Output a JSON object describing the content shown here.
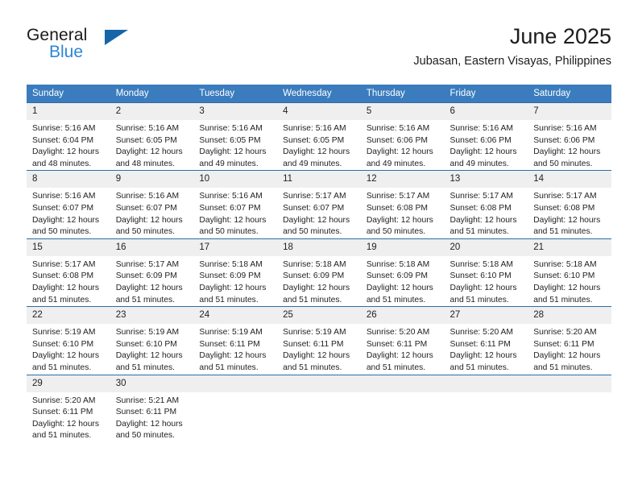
{
  "brand": {
    "name_part1": "General",
    "name_part2": "Blue",
    "triangle_color": "#1565a8",
    "blue_color": "#2e86d6"
  },
  "header": {
    "title": "June 2025",
    "subtitle": "Jubasan, Eastern Visayas, Philippines"
  },
  "theme": {
    "header_bg": "#3a7cbe",
    "row_divider": "#2e6da4",
    "daynum_bg": "#efefef"
  },
  "weekdays": [
    "Sunday",
    "Monday",
    "Tuesday",
    "Wednesday",
    "Thursday",
    "Friday",
    "Saturday"
  ],
  "days": [
    {
      "n": "1",
      "sunrise": "Sunrise: 5:16 AM",
      "sunset": "Sunset: 6:04 PM",
      "daylight": "Daylight: 12 hours and 48 minutes."
    },
    {
      "n": "2",
      "sunrise": "Sunrise: 5:16 AM",
      "sunset": "Sunset: 6:05 PM",
      "daylight": "Daylight: 12 hours and 48 minutes."
    },
    {
      "n": "3",
      "sunrise": "Sunrise: 5:16 AM",
      "sunset": "Sunset: 6:05 PM",
      "daylight": "Daylight: 12 hours and 49 minutes."
    },
    {
      "n": "4",
      "sunrise": "Sunrise: 5:16 AM",
      "sunset": "Sunset: 6:05 PM",
      "daylight": "Daylight: 12 hours and 49 minutes."
    },
    {
      "n": "5",
      "sunrise": "Sunrise: 5:16 AM",
      "sunset": "Sunset: 6:06 PM",
      "daylight": "Daylight: 12 hours and 49 minutes."
    },
    {
      "n": "6",
      "sunrise": "Sunrise: 5:16 AM",
      "sunset": "Sunset: 6:06 PM",
      "daylight": "Daylight: 12 hours and 49 minutes."
    },
    {
      "n": "7",
      "sunrise": "Sunrise: 5:16 AM",
      "sunset": "Sunset: 6:06 PM",
      "daylight": "Daylight: 12 hours and 50 minutes."
    },
    {
      "n": "8",
      "sunrise": "Sunrise: 5:16 AM",
      "sunset": "Sunset: 6:07 PM",
      "daylight": "Daylight: 12 hours and 50 minutes."
    },
    {
      "n": "9",
      "sunrise": "Sunrise: 5:16 AM",
      "sunset": "Sunset: 6:07 PM",
      "daylight": "Daylight: 12 hours and 50 minutes."
    },
    {
      "n": "10",
      "sunrise": "Sunrise: 5:16 AM",
      "sunset": "Sunset: 6:07 PM",
      "daylight": "Daylight: 12 hours and 50 minutes."
    },
    {
      "n": "11",
      "sunrise": "Sunrise: 5:17 AM",
      "sunset": "Sunset: 6:07 PM",
      "daylight": "Daylight: 12 hours and 50 minutes."
    },
    {
      "n": "12",
      "sunrise": "Sunrise: 5:17 AM",
      "sunset": "Sunset: 6:08 PM",
      "daylight": "Daylight: 12 hours and 50 minutes."
    },
    {
      "n": "13",
      "sunrise": "Sunrise: 5:17 AM",
      "sunset": "Sunset: 6:08 PM",
      "daylight": "Daylight: 12 hours and 51 minutes."
    },
    {
      "n": "14",
      "sunrise": "Sunrise: 5:17 AM",
      "sunset": "Sunset: 6:08 PM",
      "daylight": "Daylight: 12 hours and 51 minutes."
    },
    {
      "n": "15",
      "sunrise": "Sunrise: 5:17 AM",
      "sunset": "Sunset: 6:08 PM",
      "daylight": "Daylight: 12 hours and 51 minutes."
    },
    {
      "n": "16",
      "sunrise": "Sunrise: 5:17 AM",
      "sunset": "Sunset: 6:09 PM",
      "daylight": "Daylight: 12 hours and 51 minutes."
    },
    {
      "n": "17",
      "sunrise": "Sunrise: 5:18 AM",
      "sunset": "Sunset: 6:09 PM",
      "daylight": "Daylight: 12 hours and 51 minutes."
    },
    {
      "n": "18",
      "sunrise": "Sunrise: 5:18 AM",
      "sunset": "Sunset: 6:09 PM",
      "daylight": "Daylight: 12 hours and 51 minutes."
    },
    {
      "n": "19",
      "sunrise": "Sunrise: 5:18 AM",
      "sunset": "Sunset: 6:09 PM",
      "daylight": "Daylight: 12 hours and 51 minutes."
    },
    {
      "n": "20",
      "sunrise": "Sunrise: 5:18 AM",
      "sunset": "Sunset: 6:10 PM",
      "daylight": "Daylight: 12 hours and 51 minutes."
    },
    {
      "n": "21",
      "sunrise": "Sunrise: 5:18 AM",
      "sunset": "Sunset: 6:10 PM",
      "daylight": "Daylight: 12 hours and 51 minutes."
    },
    {
      "n": "22",
      "sunrise": "Sunrise: 5:19 AM",
      "sunset": "Sunset: 6:10 PM",
      "daylight": "Daylight: 12 hours and 51 minutes."
    },
    {
      "n": "23",
      "sunrise": "Sunrise: 5:19 AM",
      "sunset": "Sunset: 6:10 PM",
      "daylight": "Daylight: 12 hours and 51 minutes."
    },
    {
      "n": "24",
      "sunrise": "Sunrise: 5:19 AM",
      "sunset": "Sunset: 6:11 PM",
      "daylight": "Daylight: 12 hours and 51 minutes."
    },
    {
      "n": "25",
      "sunrise": "Sunrise: 5:19 AM",
      "sunset": "Sunset: 6:11 PM",
      "daylight": "Daylight: 12 hours and 51 minutes."
    },
    {
      "n": "26",
      "sunrise": "Sunrise: 5:20 AM",
      "sunset": "Sunset: 6:11 PM",
      "daylight": "Daylight: 12 hours and 51 minutes."
    },
    {
      "n": "27",
      "sunrise": "Sunrise: 5:20 AM",
      "sunset": "Sunset: 6:11 PM",
      "daylight": "Daylight: 12 hours and 51 minutes."
    },
    {
      "n": "28",
      "sunrise": "Sunrise: 5:20 AM",
      "sunset": "Sunset: 6:11 PM",
      "daylight": "Daylight: 12 hours and 51 minutes."
    },
    {
      "n": "29",
      "sunrise": "Sunrise: 5:20 AM",
      "sunset": "Sunset: 6:11 PM",
      "daylight": "Daylight: 12 hours and 51 minutes."
    },
    {
      "n": "30",
      "sunrise": "Sunrise: 5:21 AM",
      "sunset": "Sunset: 6:11 PM",
      "daylight": "Daylight: 12 hours and 50 minutes."
    }
  ],
  "grid": {
    "leading_blanks": 0,
    "trailing_blanks": 5,
    "weeks": 5
  }
}
